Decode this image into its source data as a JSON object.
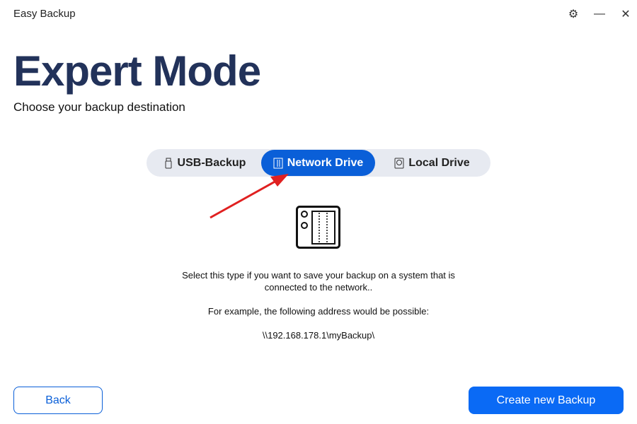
{
  "window": {
    "title": "Easy Backup",
    "settings_icon": "gear-icon",
    "minimize_icon": "minimize-icon",
    "close_icon": "close-icon"
  },
  "header": {
    "title": "Expert Mode",
    "subtitle": "Choose your backup destination"
  },
  "tabs": [
    {
      "label": "USB-Backup",
      "icon": "usb-stick-icon",
      "active": false
    },
    {
      "label": "Network Drive",
      "icon": "nas-icon",
      "active": true
    },
    {
      "label": "Local Drive",
      "icon": "hard-drive-icon",
      "active": false
    }
  ],
  "content": {
    "icon": "nas-icon",
    "line1": "Select this type if you want to save your backup on a system that is",
    "line2": "connected to the network..",
    "example": "For example, the following address would be possible:",
    "address": "\\\\192.168.178.1\\myBackup\\"
  },
  "footer": {
    "back_label": "Back",
    "create_label": "Create new Backup"
  },
  "colors": {
    "accent": "#0a5fd8",
    "title": "#22325a",
    "annotation_arrow": "#e02020"
  }
}
